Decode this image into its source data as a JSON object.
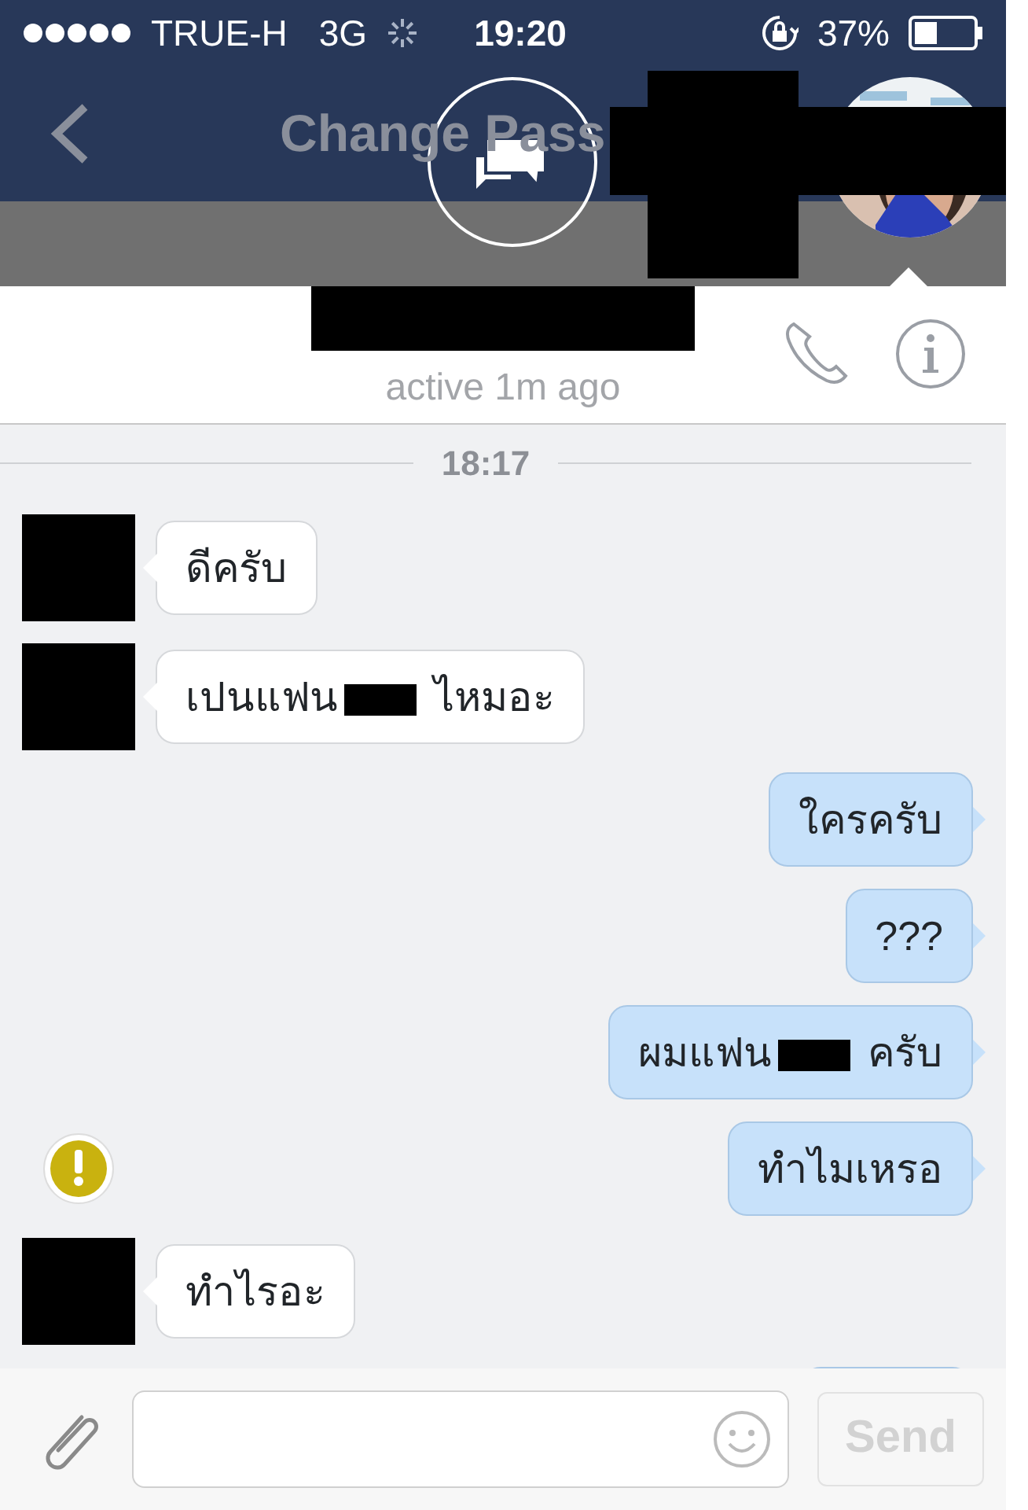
{
  "status_bar": {
    "carrier": "TRUE-H",
    "network": "3G",
    "time": "19:20",
    "battery": "37%"
  },
  "nav_bar": {
    "title": "Change Pass"
  },
  "chat": {
    "status": "active 1m ago",
    "time_divider": "18:17",
    "messages": [
      {
        "kind": "incoming",
        "avatar_redacted": true,
        "segments": [
          {
            "kind": "text",
            "text": "ดีครับ"
          }
        ]
      },
      {
        "kind": "incoming",
        "avatar_redacted": true,
        "segments": [
          {
            "kind": "text",
            "text": "เปนแฟน"
          },
          {
            "kind": "redaction"
          },
          {
            "kind": "text",
            "text": "ไหมอะ"
          }
        ]
      },
      {
        "kind": "outgoing",
        "segments": [
          {
            "kind": "text",
            "text": "ใครครับ"
          }
        ]
      },
      {
        "kind": "outgoing",
        "segments": [
          {
            "kind": "text",
            "text": "???"
          }
        ]
      },
      {
        "kind": "outgoing",
        "segments": [
          {
            "kind": "text",
            "text": "ผมแฟน"
          },
          {
            "kind": "redaction"
          },
          {
            "kind": "text",
            "text": "ครับ"
          }
        ]
      },
      {
        "kind": "outgoing",
        "warning": true,
        "segments": [
          {
            "kind": "text",
            "text": "ทำไมเหรอ"
          }
        ]
      },
      {
        "kind": "incoming",
        "avatar_redacted": true,
        "segments": [
          {
            "kind": "text",
            "text": "ทำไรอะ"
          }
        ]
      },
      {
        "kind": "outgoing",
        "cut": true
      }
    ]
  },
  "composer": {
    "send": "Send",
    "send_disabled": true
  }
}
